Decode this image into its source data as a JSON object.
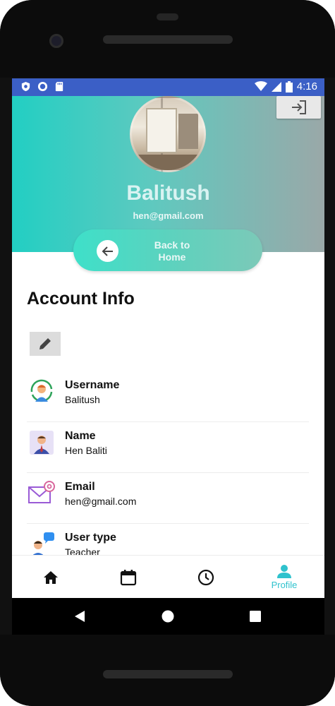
{
  "status_bar": {
    "time": "4:16"
  },
  "header": {
    "name": "Balitush",
    "email": "hen@gmail.com",
    "back_button_label": "Back to Home"
  },
  "account": {
    "title": "Account Info",
    "fields": [
      {
        "label": "Username",
        "value": "Balitush",
        "icon": "user-sync-icon"
      },
      {
        "label": "Name",
        "value": "Hen Baliti",
        "icon": "person-card-icon"
      },
      {
        "label": "Email",
        "value": "hen@gmail.com",
        "icon": "email-icon"
      },
      {
        "label": "User type",
        "value": "Teacher",
        "icon": "chat-user-icon"
      }
    ]
  },
  "bottom_nav": {
    "items": [
      {
        "icon": "home-icon",
        "label": ""
      },
      {
        "icon": "calendar-icon",
        "label": ""
      },
      {
        "icon": "clock-icon",
        "label": ""
      },
      {
        "icon": "profile-icon",
        "label": "Profile"
      }
    ],
    "active_color": "#2fc2cd"
  },
  "colors": {
    "status_bar": "#3b5fc6",
    "header_start": "#22cfc3",
    "header_end": "#9aa8a8"
  }
}
